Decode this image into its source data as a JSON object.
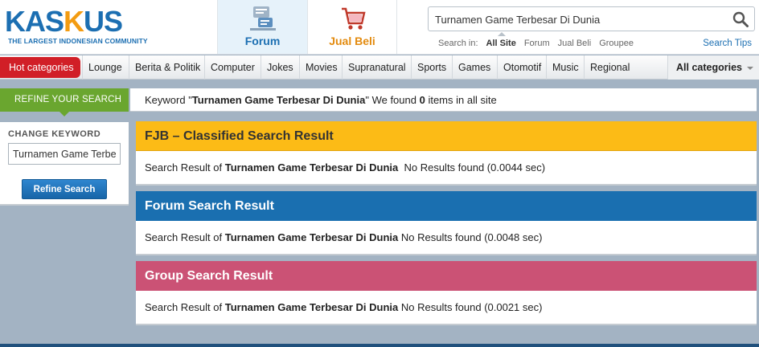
{
  "logo": {
    "text_part1": "KAS",
    "text_part2": "K",
    "text_part3": "US",
    "tagline": "THE LARGEST INDONESIAN COMMUNITY"
  },
  "nav_tabs": {
    "forum": "Forum",
    "jualbeli": "Jual Beli"
  },
  "search": {
    "value": "Turnamen Game Terbesar Di Dunia",
    "search_in_label": "Search in:",
    "options": [
      "All Site",
      "Forum",
      "Jual Beli",
      "Groupee"
    ],
    "tips": "Search Tips"
  },
  "categories": {
    "hot": "Hot categories",
    "items": [
      "Lounge",
      "Berita & Politik",
      "Computer",
      "Jokes",
      "Movies",
      "Supranatural",
      "Sports",
      "Games",
      "Otomotif",
      "Music",
      "Regional"
    ],
    "all": "All categories"
  },
  "refine": {
    "tab": "REFINE YOUR SEARCH",
    "kw_prefix": "Keyword \"",
    "kw_value": "Turnamen Game Terbesar Di Dunia",
    "kw_mid": "\" We found ",
    "kw_count": "0",
    "kw_suffix": " items in all site"
  },
  "sidebar": {
    "title": "CHANGE KEYWORD",
    "input_value": "Turnamen Game Terbesar Di Dunia",
    "button": "Refine Search"
  },
  "panels": [
    {
      "title": "FJB – Classified Search Result",
      "prefix": "Search Result of ",
      "keyword": "Turnamen Game Terbesar Di Dunia",
      "result": "  No Results found (0.0044 sec)"
    },
    {
      "title": "Forum Search Result",
      "prefix": "Search Result of ",
      "keyword": "Turnamen Game Terbesar Di Dunia",
      "result": " No Results found (0.0048 sec)"
    },
    {
      "title": "Group Search Result",
      "prefix": "Search Result of ",
      "keyword": "Turnamen Game Terbesar Di Dunia",
      "result": " No Results found (0.0021 sec)"
    }
  ],
  "colors": {
    "brand_blue": "#1c6fb2",
    "brand_orange": "#f39c12",
    "fjb": "#fcbb16",
    "forum": "#1a6fb0",
    "group": "#cb5275",
    "refine": "#6aa62f",
    "hot": "#d11f27"
  }
}
